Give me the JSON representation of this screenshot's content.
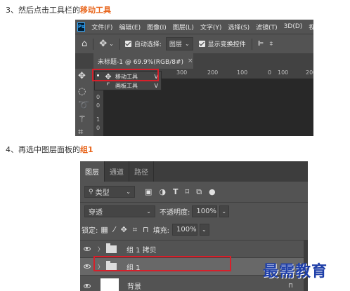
{
  "step3": {
    "prefix": "3、然后点击工具栏的",
    "highlight": "移动工具"
  },
  "step4": {
    "prefix": "4、再选中图层面板的",
    "highlight": "组1"
  },
  "ps1": {
    "logo": "Ps",
    "menu": [
      "文件(F)",
      "编辑(E)",
      "图像(I)",
      "图层(L)",
      "文字(Y)",
      "选择(S)",
      "滤镜(T)",
      "3D(D)",
      "视图"
    ],
    "options": {
      "auto_select": "自动选择:",
      "target": "图层",
      "show_transform": "显示变换控件"
    },
    "doc_tab": "未标题-1 @ 69.9%(RGB/8#)",
    "doc_close": "×",
    "ruler_h": [
      "300",
      "200",
      "100",
      "0",
      "100",
      "200"
    ],
    "ruler_v": [
      "0",
      "0",
      "1",
      "0"
    ],
    "flyout": [
      {
        "icon": "move-icon",
        "label": "移动工具",
        "key": "V"
      },
      {
        "icon": "artboard-icon",
        "label": "画板工具",
        "key": "V"
      }
    ]
  },
  "ps2": {
    "tabs": [
      "图层",
      "通道",
      "路径"
    ],
    "filter_kind": "类型",
    "blend_mode": "穿透",
    "opacity_label": "不透明度:",
    "opacity": "100%",
    "lock_label": "锁定:",
    "fill_label": "填充:",
    "fill": "100%",
    "layers": [
      {
        "name": "组 1 拷贝",
        "type": "group"
      },
      {
        "name": "组 1",
        "type": "group",
        "selected": true
      },
      {
        "name": "背景",
        "type": "background"
      }
    ]
  },
  "watermark": "最需教育",
  "colors": {
    "highlight": "#e8641a",
    "red_box": "#d81f2a",
    "ps_panel": "#535353",
    "ps_dark": "#282828"
  }
}
